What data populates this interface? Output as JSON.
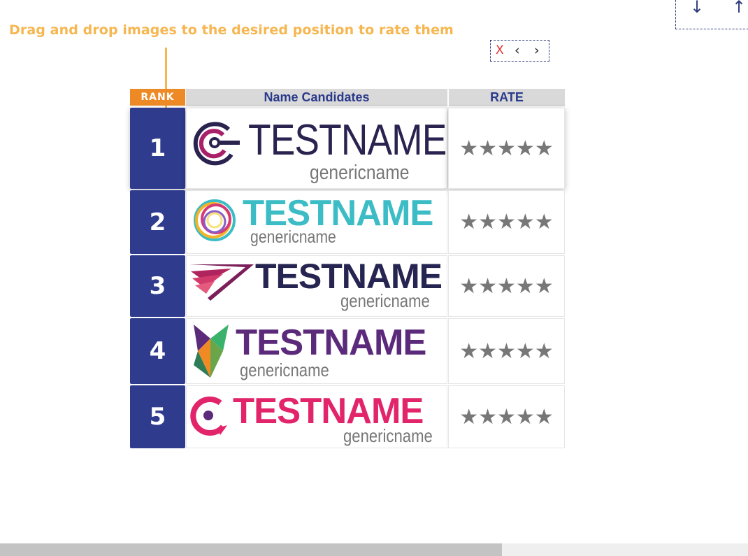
{
  "instruction": "Drag and drop images to the desired position to rate them",
  "nav": {
    "close": "X",
    "prev": "‹",
    "next": "›"
  },
  "sort": {
    "down": "↓",
    "up": "↑"
  },
  "headers": {
    "rank": "RANK",
    "name": "Name Candidates",
    "rate": "RATE"
  },
  "rows": [
    {
      "rank": "1",
      "brand": "TESTNAME",
      "sub": "genericname",
      "stars": "★★★★★",
      "rating": 0,
      "brand_color": "#2a2350",
      "logo": "concentric-g-icon"
    },
    {
      "rank": "2",
      "brand": "TESTNAME",
      "sub": "genericname",
      "stars": "★★★★★",
      "rating": 0,
      "brand_color": "#3cbcc5",
      "logo": "color-ring-icon"
    },
    {
      "rank": "3",
      "brand": "TESTNAME",
      "sub": "genericname",
      "stars": "★★★★★",
      "rating": 0,
      "brand_color": "#262450",
      "logo": "wing-stripes-icon"
    },
    {
      "rank": "4",
      "brand": "TESTNAME",
      "sub": "genericname",
      "stars": "★★★★★",
      "rating": 0,
      "brand_color": "#5b2a7a",
      "logo": "geometric-fox-icon"
    },
    {
      "rank": "5",
      "brand": "TESTNAME",
      "sub": "genericname",
      "stars": "★★★★★",
      "rating": 0,
      "brand_color": "#e2246a",
      "logo": "c-dot-icon"
    }
  ],
  "colors": {
    "instruction": "#f6b650",
    "rank_bg": "#2f3c8e",
    "rank_header": "#ee8a25",
    "star": "#777777"
  }
}
